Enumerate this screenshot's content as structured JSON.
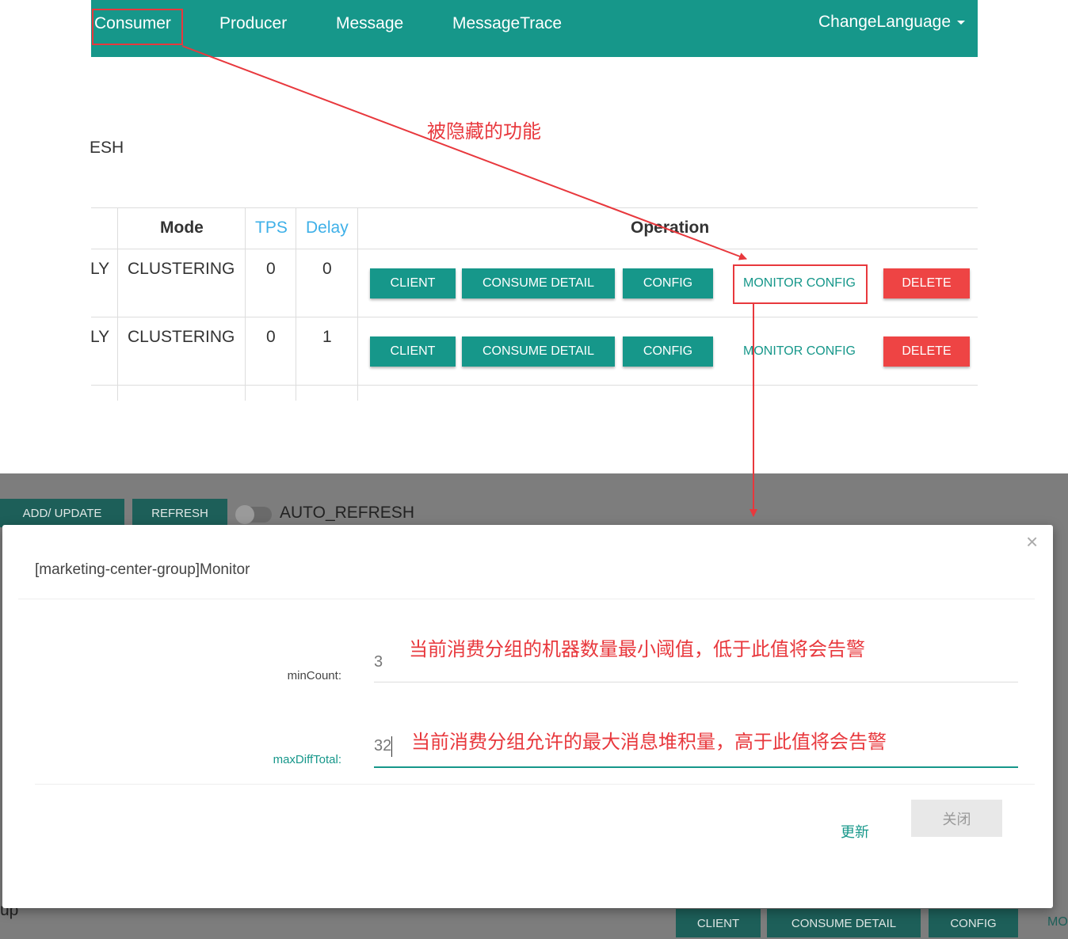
{
  "navbar": {
    "items": [
      "Consumer",
      "Producer",
      "Message",
      "MessageTrace"
    ],
    "change_language": "ChangeLanguage"
  },
  "annotations": {
    "hidden_feature": "被隐藏的功能",
    "min_count_note": "当前消费分组的机器数量最小阈值，低于此值将会告警",
    "max_diff_note": "当前消费分组允许的最大消息堆积量，高于此值将会告警"
  },
  "top_fragment": {
    "refresh_partial": "ESH"
  },
  "table": {
    "headers": {
      "mode": "Mode",
      "tps": "TPS",
      "delay": "Delay",
      "operation": "Operation"
    },
    "rows": [
      {
        "consume_type_partial": "LY",
        "mode": "CLUSTERING",
        "tps": "0",
        "delay": "0"
      },
      {
        "consume_type_partial": "LY",
        "mode": "CLUSTERING",
        "tps": "0",
        "delay": "1"
      }
    ],
    "buttons": {
      "client": "CLIENT",
      "consume_detail": "CONSUME DETAIL",
      "config": "CONFIG",
      "monitor_config": "MONITOR CONFIG",
      "delete": "DELETE"
    }
  },
  "background_page": {
    "add_update": "ADD/ UPDATE",
    "refresh": "REFRESH",
    "auto_refresh": "AUTO_REFRESH",
    "partial_row_text": "up",
    "bottom_client": "CLIENT",
    "bottom_consume_detail": "CONSUME DETAIL",
    "bottom_config": "CONFIG",
    "partial_mo": "MO"
  },
  "modal": {
    "title": "[marketing-center-group]Monitor",
    "close_x": "×",
    "min_count": {
      "label": "minCount:",
      "value": "3"
    },
    "max_diff_total": {
      "label": "maxDiffTotal:",
      "value": "32"
    },
    "update_button": "更新",
    "close_button": "关闭"
  },
  "colors": {
    "primary": "#16978a",
    "danger": "#ee4444",
    "annotation": "#e8383d"
  }
}
